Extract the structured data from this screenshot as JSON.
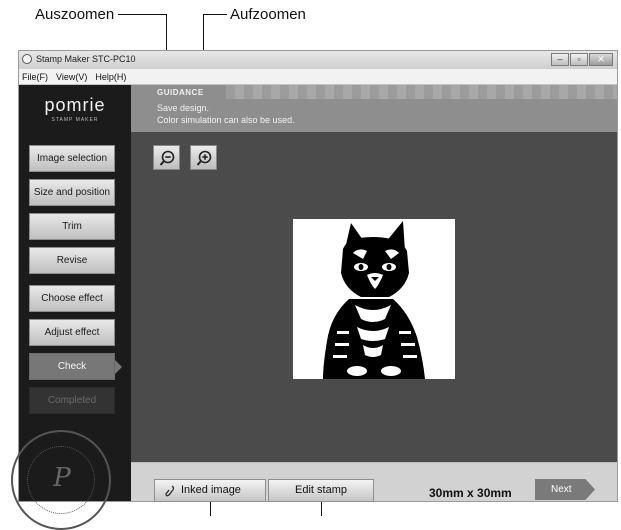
{
  "annotations": {
    "zoom_out_label": "Auszoomen",
    "zoom_in_label": "Aufzoomen"
  },
  "window": {
    "title": "Stamp Maker STC-PC10",
    "controls": [
      "–",
      "▫",
      "✕"
    ]
  },
  "menu": [
    "File(F)",
    "View(V)",
    "Help(H)"
  ],
  "brand": {
    "name": "pomrie",
    "subtitle": "STAMP MAKER"
  },
  "steps": [
    {
      "label": "Image selection",
      "state": "normal"
    },
    {
      "label": "Size and position",
      "state": "normal"
    },
    {
      "label": "Trim",
      "state": "normal"
    },
    {
      "label": "Revise",
      "state": "normal"
    },
    {
      "label": "Choose effect",
      "state": "normal"
    },
    {
      "label": "Adjust effect",
      "state": "normal"
    },
    {
      "label": "Check",
      "state": "active"
    },
    {
      "label": "Completed",
      "state": "disabled"
    }
  ],
  "guidance": {
    "title": "GUIDANCE",
    "line1": "Save design.",
    "line2": "Color simulation can also be used."
  },
  "icons": {
    "zoom_out": "zoom-out-magnifier-icon",
    "zoom_in": "zoom-in-magnifier-icon",
    "inked": "inked-image-icon",
    "preview": "cat-stamp-image"
  },
  "footer": {
    "inked_image_label": "Inked image",
    "edit_stamp_label": "Edit stamp",
    "size": "30mm x 30mm",
    "next_label": "Next"
  },
  "colors": {
    "sidebar": "#1b1b1b",
    "canvas": "#4b4b4b",
    "active_step": "#777777",
    "guidance": "#8e8e8e"
  }
}
